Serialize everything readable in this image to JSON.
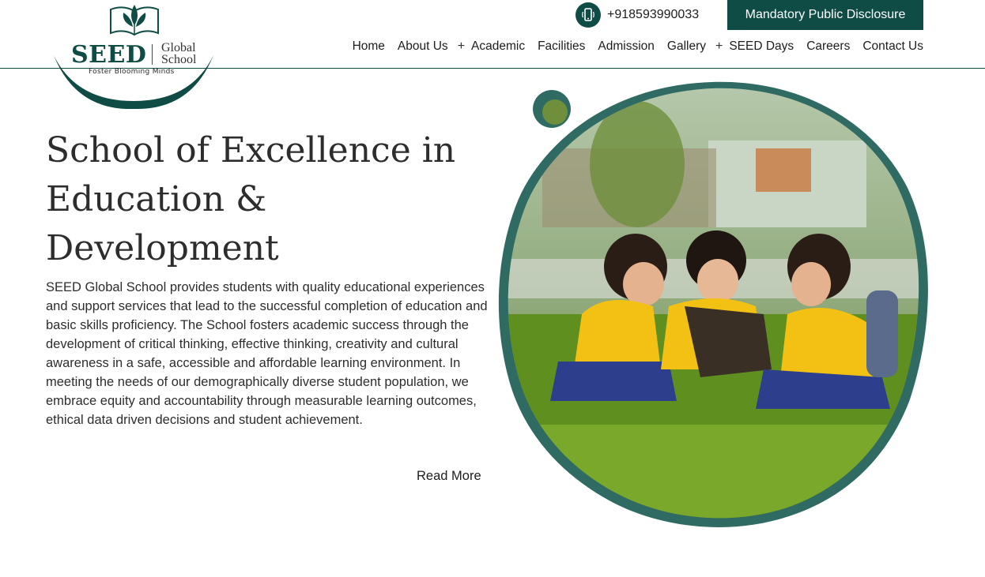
{
  "header": {
    "logo": {
      "brand": "SEED",
      "sub_line1": "Global",
      "sub_line2": "School",
      "tagline": "Foster Blooming Minds"
    },
    "phone": "+918593990033",
    "disclosure_label": "Mandatory Public Disclosure",
    "nav": {
      "home": "Home",
      "about": "About Us",
      "academic": "Academic",
      "facilities": "Facilities",
      "admission": "Admission",
      "gallery": "Gallery",
      "seed_days": "SEED Days",
      "careers": "Careers",
      "contact": "Contact Us"
    },
    "plus_glyph": "+"
  },
  "hero": {
    "title": "School of Excellence in Education & Development",
    "body": "SEED Global School provides students with quality educational experiences and support services that lead to the successful completion of education and basic skills proficiency. The School fosters academic success through the development of critical thinking, effective thinking, creativity and cultural awareness in a safe, accessible and affordable learning environment. In meeting the needs of our demographically diverse student population, we embrace equity and accountability through measurable learning outcomes, ethical data driven decisions and student achievement.",
    "read_more": "Read More"
  },
  "colors": {
    "brand": "#0f4c45",
    "text": "#2d2d2d"
  }
}
